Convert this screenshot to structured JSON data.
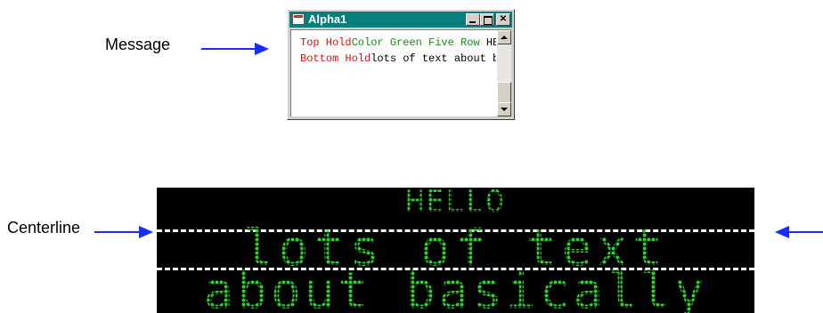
{
  "annotations": {
    "message_label": "Message",
    "centerline_label": "Centerline",
    "arrow_color": "#1a2bff"
  },
  "window": {
    "title": "Alpha1",
    "title_bar_color": "#087f7c",
    "controls": {
      "minimize_icon": "minimize-icon",
      "maximize_icon": "maximize-icon",
      "close_icon": "close-icon"
    },
    "lines": [
      [
        {
          "text": "Top Hold",
          "color": "red"
        },
        {
          "text": "Color Green",
          "color": "green"
        },
        {
          "text": "Five Row",
          "color": "green"
        },
        {
          "text": "HELLO",
          "color": "black"
        }
      ],
      [
        {
          "text": "Bottom Hold",
          "color": "red"
        },
        {
          "text": "lots of text about basically",
          "color": "black"
        }
      ]
    ]
  },
  "led_display": {
    "led_color": "#2fd12f",
    "rows": [
      {
        "text": "HELLO"
      },
      {
        "text": "lots of text"
      },
      {
        "text": "about basically"
      }
    ]
  }
}
